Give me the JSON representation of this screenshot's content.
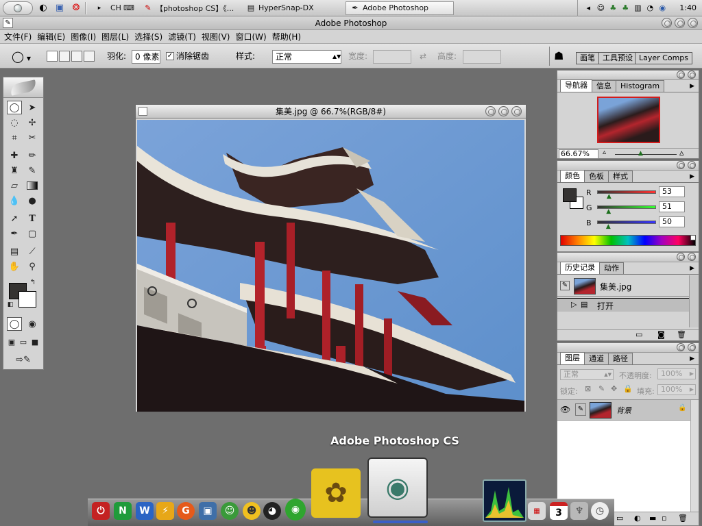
{
  "taskbar": {
    "lang": "CH",
    "tasks": [
      {
        "label": "【photoshop CS】《...",
        "icon": "ps-note-icon"
      },
      {
        "label": "HyperSnap-DX",
        "icon": "hypersnap-icon"
      },
      {
        "label": "Adobe Photoshop",
        "icon": "photoshop-icon",
        "active": true
      }
    ],
    "clock": "1:40"
  },
  "app": {
    "title": "Adobe Photoshop"
  },
  "menu": [
    "文件(F)",
    "编辑(E)",
    "图像(I)",
    "图层(L)",
    "选择(S)",
    "滤镜(T)",
    "视图(V)",
    "窗口(W)",
    "帮助(H)"
  ],
  "options": {
    "feather_label": "羽化:",
    "feather_value": "0 像素",
    "antialias_label": "消除锯齿",
    "antialias_checked": true,
    "style_label": "样式:",
    "style_value": "正常",
    "width_label": "宽度:",
    "height_label": "高度:",
    "wells": [
      "画笔",
      "工具预设",
      "Layer Comps"
    ]
  },
  "document": {
    "title": "集美.jpg @ 66.7%(RGB/8#)"
  },
  "navigator": {
    "tabs": [
      "导航器",
      "信息",
      "Histogram"
    ],
    "zoom": "66.67%"
  },
  "color": {
    "tabs": [
      "颜色",
      "色板",
      "样式"
    ],
    "channels": [
      {
        "name": "R",
        "value": "53",
        "fraction": 0.208
      },
      {
        "name": "G",
        "value": "51",
        "fraction": 0.2
      },
      {
        "name": "B",
        "value": "50",
        "fraction": 0.196
      }
    ],
    "foreground": "#353332"
  },
  "history": {
    "tabs": [
      "历史记录",
      "动作"
    ],
    "snapshot": "集美.jpg",
    "steps": [
      "打开"
    ]
  },
  "layers": {
    "tabs": [
      "图层",
      "通道",
      "路径"
    ],
    "blend_mode": "正常",
    "opacity_label": "不透明度:",
    "opacity_value": "100%",
    "lock_label": "锁定:",
    "fill_label": "填充:",
    "fill_value": "100%",
    "layer_name": "背景"
  },
  "dock": {
    "label": "Adobe Photoshop CS",
    "calendar_day": "3"
  }
}
